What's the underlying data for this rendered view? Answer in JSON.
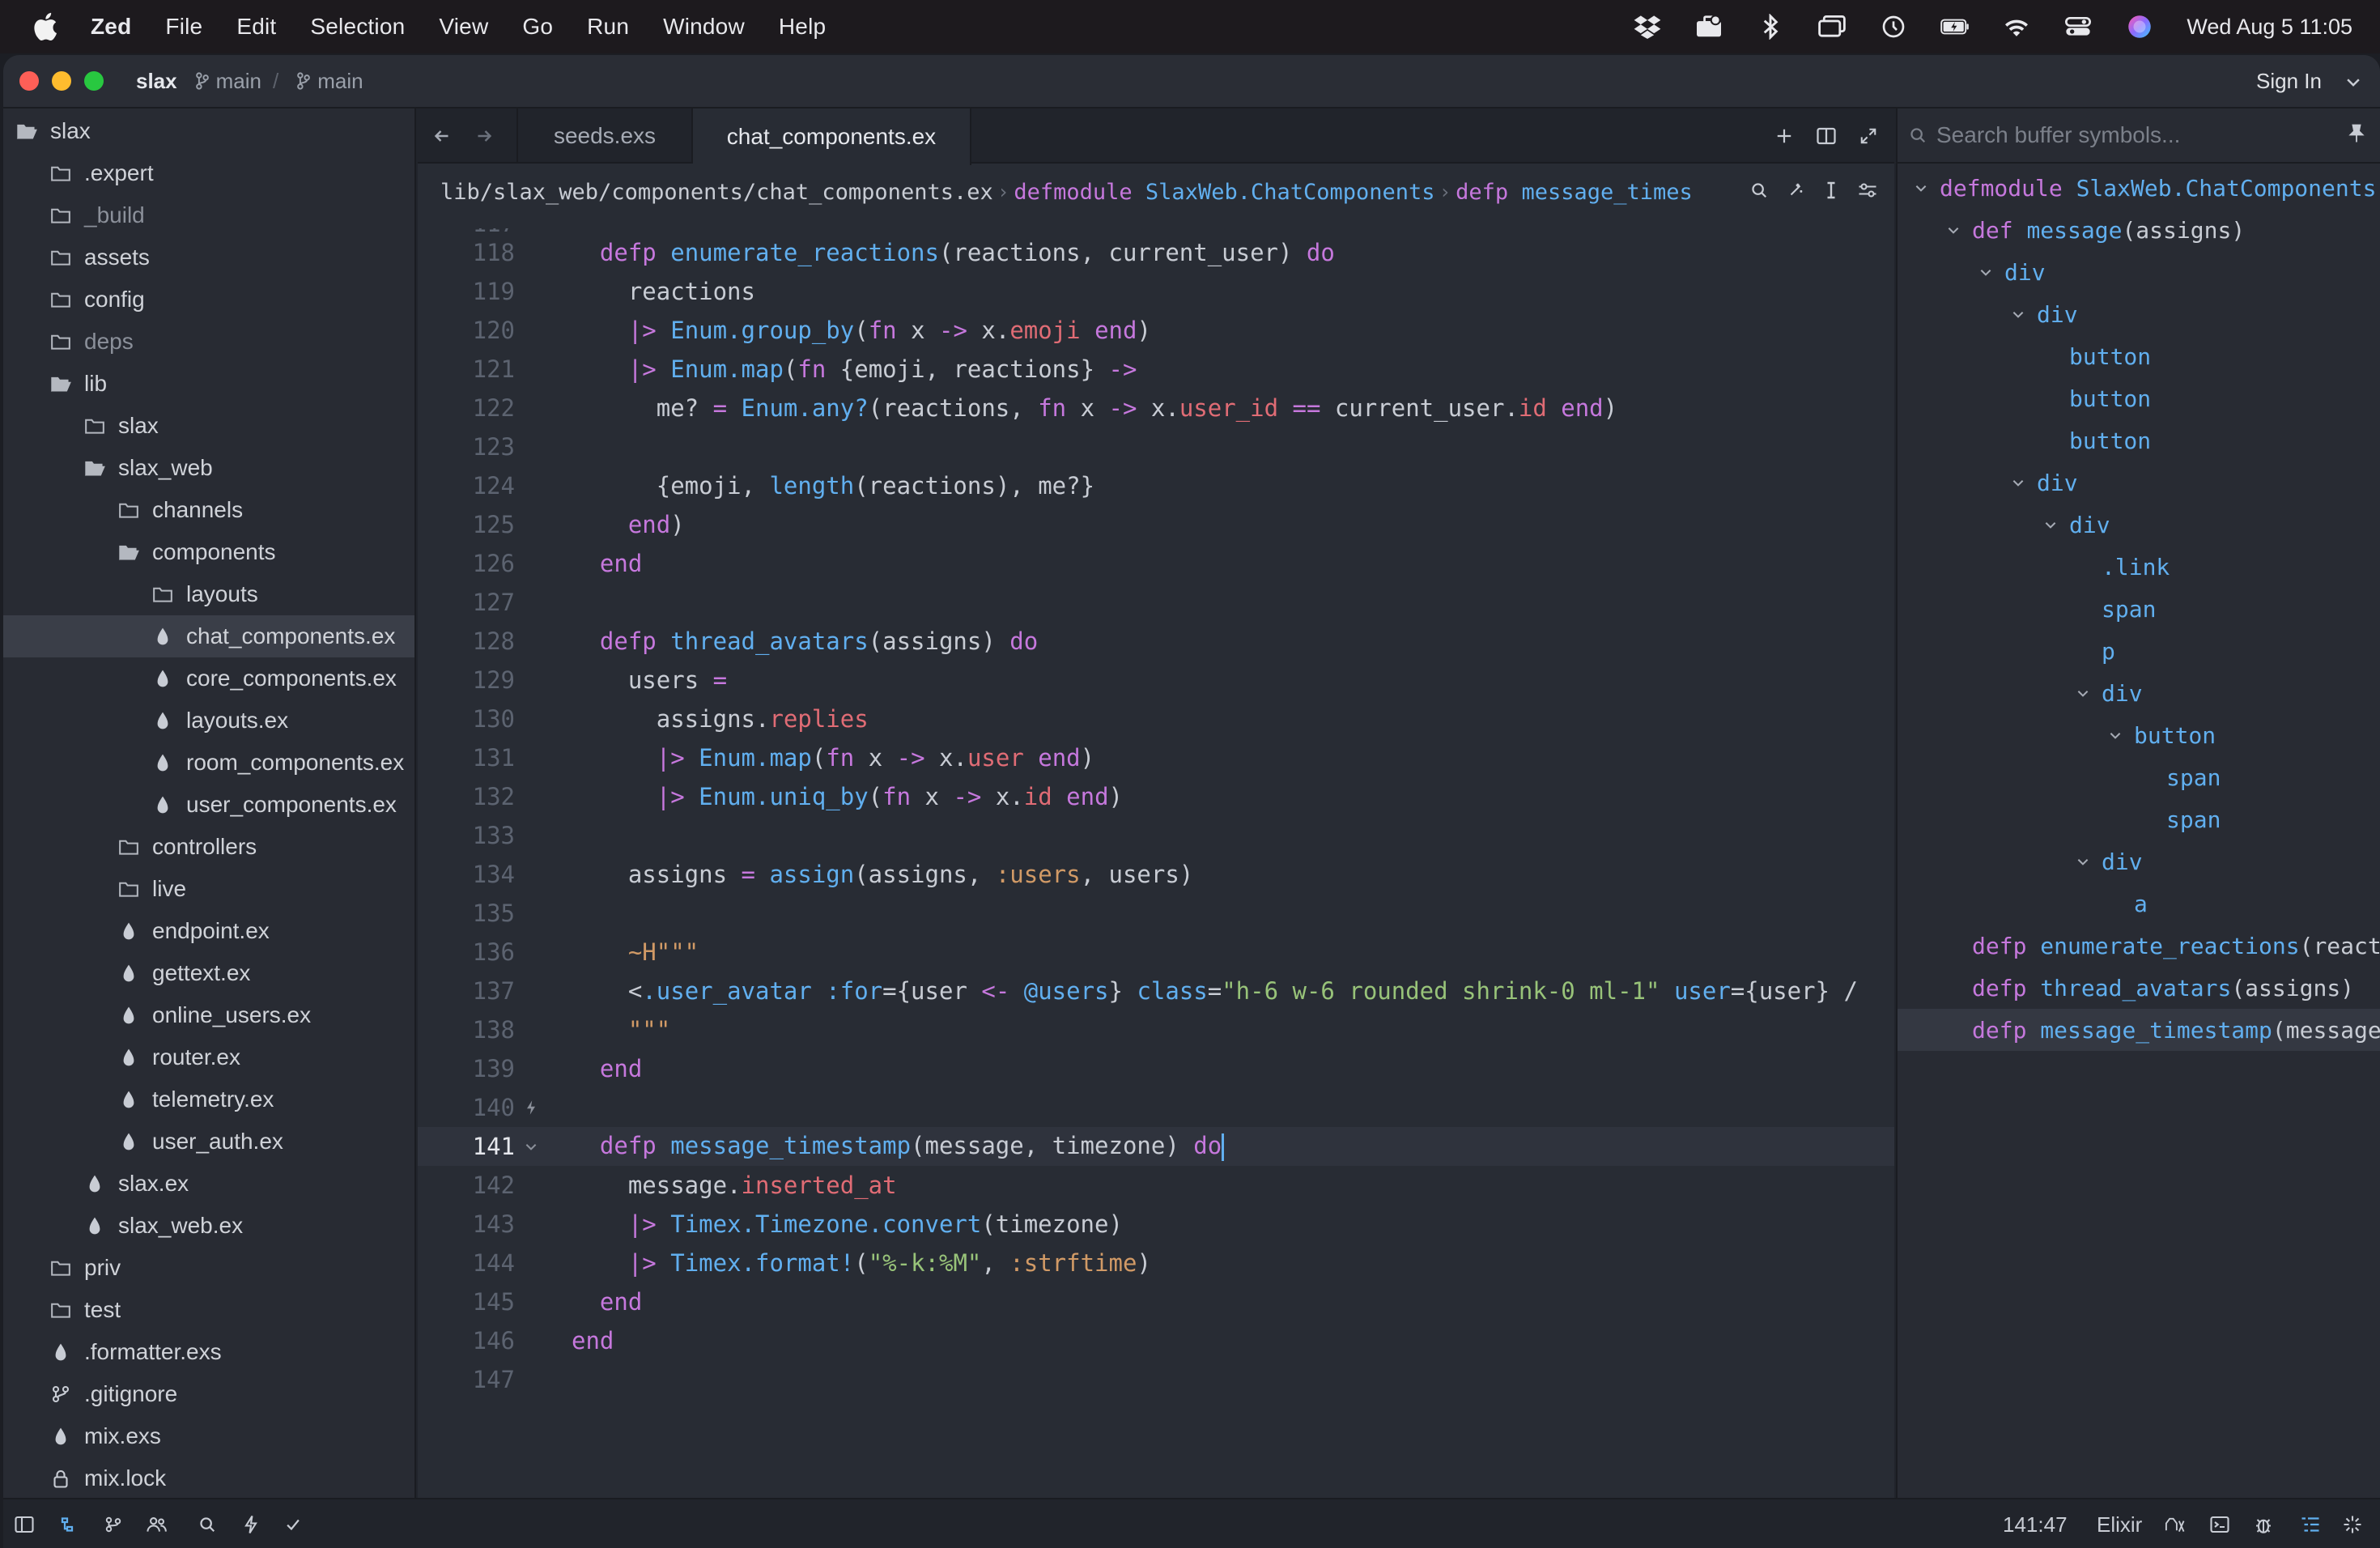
{
  "menubar": {
    "app": "Zed",
    "items": [
      "File",
      "Edit",
      "Selection",
      "View",
      "Go",
      "Run",
      "Window",
      "Help"
    ],
    "clock": "Wed Aug 5  11:05",
    "status_icons": [
      "dropbox-icon",
      "briefcase-icon",
      "bluetooth-icon",
      "screens-icon",
      "time-machine-icon",
      "battery-icon",
      "wifi-icon",
      "control-center-icon",
      "siri-icon"
    ]
  },
  "titlebar": {
    "project": "slax",
    "branch1": "main",
    "branch2": "main",
    "sign_in": "Sign In"
  },
  "project_panel": {
    "rows": [
      {
        "label": "slax",
        "icon": "folder-open",
        "depth": 0
      },
      {
        "label": ".expert",
        "icon": "folder",
        "depth": 1
      },
      {
        "label": "_build",
        "icon": "folder",
        "depth": 1,
        "dim": true
      },
      {
        "label": "assets",
        "icon": "folder",
        "depth": 1
      },
      {
        "label": "config",
        "icon": "folder",
        "depth": 1
      },
      {
        "label": "deps",
        "icon": "folder",
        "depth": 1,
        "dim": true
      },
      {
        "label": "lib",
        "icon": "folder-open",
        "depth": 1
      },
      {
        "label": "slax",
        "icon": "folder",
        "depth": 2
      },
      {
        "label": "slax_web",
        "icon": "folder-open",
        "depth": 2
      },
      {
        "label": "channels",
        "icon": "folder",
        "depth": 3
      },
      {
        "label": "components",
        "icon": "folder-open",
        "depth": 3
      },
      {
        "label": "layouts",
        "icon": "folder",
        "depth": 4
      },
      {
        "label": "chat_components.ex",
        "icon": "elixir",
        "depth": 4,
        "selected": true
      },
      {
        "label": "core_components.ex",
        "icon": "elixir",
        "depth": 4
      },
      {
        "label": "layouts.ex",
        "icon": "elixir",
        "depth": 4
      },
      {
        "label": "room_components.ex",
        "icon": "elixir",
        "depth": 4
      },
      {
        "label": "user_components.ex",
        "icon": "elixir",
        "depth": 4
      },
      {
        "label": "controllers",
        "icon": "folder",
        "depth": 3
      },
      {
        "label": "live",
        "icon": "folder",
        "depth": 3
      },
      {
        "label": "endpoint.ex",
        "icon": "elixir",
        "depth": 3
      },
      {
        "label": "gettext.ex",
        "icon": "elixir",
        "depth": 3
      },
      {
        "label": "online_users.ex",
        "icon": "elixir",
        "depth": 3
      },
      {
        "label": "router.ex",
        "icon": "elixir",
        "depth": 3
      },
      {
        "label": "telemetry.ex",
        "icon": "elixir",
        "depth": 3
      },
      {
        "label": "user_auth.ex",
        "icon": "elixir",
        "depth": 3
      },
      {
        "label": "slax.ex",
        "icon": "elixir",
        "depth": 2
      },
      {
        "label": "slax_web.ex",
        "icon": "elixir",
        "depth": 2
      },
      {
        "label": "priv",
        "icon": "folder",
        "depth": 1
      },
      {
        "label": "test",
        "icon": "folder",
        "depth": 1
      },
      {
        "label": ".formatter.exs",
        "icon": "elixir",
        "depth": 1
      },
      {
        "label": ".gitignore",
        "icon": "git",
        "depth": 1
      },
      {
        "label": "mix.exs",
        "icon": "elixir",
        "depth": 1
      },
      {
        "label": "mix.lock",
        "icon": "lock",
        "depth": 1
      }
    ]
  },
  "tabs": {
    "items": [
      {
        "label": "seeds.exs",
        "active": false
      },
      {
        "label": "chat_components.ex",
        "active": true
      }
    ]
  },
  "breadcrumb": {
    "path": "lib/slax_web/components/chat_components.ex",
    "kw1": "defmodule",
    "module": "SlaxWeb.ChatComponents",
    "kw2": "defp",
    "fn": "message_times"
  },
  "editor": {
    "top_partial_line": "117",
    "lines": [
      {
        "n": "118",
        "tokens": [
          [
            "k",
            "defp "
          ],
          [
            "f",
            "enumerate_reactions"
          ],
          [
            "p",
            "(reactions, current_user) "
          ],
          [
            "k",
            "do"
          ]
        ],
        "indent": 1
      },
      {
        "n": "119",
        "tokens": [
          [
            "p",
            "reactions"
          ]
        ],
        "indent": 2
      },
      {
        "n": "120",
        "tokens": [
          [
            "k",
            "|> "
          ],
          [
            "f",
            "Enum.group_by"
          ],
          [
            "p",
            "("
          ],
          [
            "k",
            "fn "
          ],
          [
            "p",
            "x "
          ],
          [
            "k",
            "-> "
          ],
          [
            "p",
            "x."
          ],
          [
            "fld",
            "emoji"
          ],
          [
            "p",
            " "
          ],
          [
            "k",
            "end"
          ],
          [
            "p",
            ")"
          ]
        ],
        "indent": 2
      },
      {
        "n": "121",
        "tokens": [
          [
            "k",
            "|> "
          ],
          [
            "f",
            "Enum.map"
          ],
          [
            "p",
            "("
          ],
          [
            "k",
            "fn "
          ],
          [
            "p",
            "{emoji, reactions} "
          ],
          [
            "k",
            "->"
          ]
        ],
        "indent": 2
      },
      {
        "n": "122",
        "tokens": [
          [
            "p",
            "me? "
          ],
          [
            "k",
            "= "
          ],
          [
            "f",
            "Enum.any?"
          ],
          [
            "p",
            "(reactions, "
          ],
          [
            "k",
            "fn "
          ],
          [
            "p",
            "x "
          ],
          [
            "k",
            "-> "
          ],
          [
            "p",
            "x."
          ],
          [
            "fld",
            "user_id"
          ],
          [
            "p",
            " "
          ],
          [
            "k",
            "== "
          ],
          [
            "p",
            "current_user."
          ],
          [
            "fld",
            "id"
          ],
          [
            "p",
            " "
          ],
          [
            "k",
            "end"
          ],
          [
            "p",
            ")"
          ]
        ],
        "indent": 3
      },
      {
        "n": "123",
        "tokens": [],
        "indent": 0
      },
      {
        "n": "124",
        "tokens": [
          [
            "p",
            "{emoji, "
          ],
          [
            "f",
            "length"
          ],
          [
            "p",
            "(reactions), me?}"
          ]
        ],
        "indent": 3
      },
      {
        "n": "125",
        "tokens": [
          [
            "k",
            "end"
          ],
          [
            "p",
            ")"
          ]
        ],
        "indent": 2
      },
      {
        "n": "126",
        "tokens": [
          [
            "k",
            "end"
          ]
        ],
        "indent": 1
      },
      {
        "n": "127",
        "tokens": [],
        "indent": 0
      },
      {
        "n": "128",
        "tokens": [
          [
            "k",
            "defp "
          ],
          [
            "f",
            "thread_avatars"
          ],
          [
            "p",
            "(assigns) "
          ],
          [
            "k",
            "do"
          ]
        ],
        "indent": 1
      },
      {
        "n": "129",
        "tokens": [
          [
            "p",
            "users "
          ],
          [
            "k",
            "="
          ]
        ],
        "indent": 2
      },
      {
        "n": "130",
        "tokens": [
          [
            "p",
            "assigns."
          ],
          [
            "fld",
            "replies"
          ]
        ],
        "indent": 3
      },
      {
        "n": "131",
        "tokens": [
          [
            "k",
            "|> "
          ],
          [
            "f",
            "Enum.map"
          ],
          [
            "p",
            "("
          ],
          [
            "k",
            "fn "
          ],
          [
            "p",
            "x "
          ],
          [
            "k",
            "-> "
          ],
          [
            "p",
            "x."
          ],
          [
            "fld",
            "user"
          ],
          [
            "p",
            " "
          ],
          [
            "k",
            "end"
          ],
          [
            "p",
            ")"
          ]
        ],
        "indent": 3
      },
      {
        "n": "132",
        "tokens": [
          [
            "k",
            "|> "
          ],
          [
            "f",
            "Enum.uniq_by"
          ],
          [
            "p",
            "("
          ],
          [
            "k",
            "fn "
          ],
          [
            "p",
            "x "
          ],
          [
            "k",
            "-> "
          ],
          [
            "p",
            "x."
          ],
          [
            "fld",
            "id"
          ],
          [
            "p",
            " "
          ],
          [
            "k",
            "end"
          ],
          [
            "p",
            ")"
          ]
        ],
        "indent": 3
      },
      {
        "n": "133",
        "tokens": [],
        "indent": 0
      },
      {
        "n": "134",
        "tokens": [
          [
            "p",
            "assigns "
          ],
          [
            "k",
            "= "
          ],
          [
            "f",
            "assign"
          ],
          [
            "p",
            "(assigns, "
          ],
          [
            "a",
            ":users"
          ],
          [
            "p",
            ", users)"
          ]
        ],
        "indent": 2
      },
      {
        "n": "135",
        "tokens": [],
        "indent": 0
      },
      {
        "n": "136",
        "tokens": [
          [
            "a",
            "~H\"\"\""
          ]
        ],
        "indent": 2
      },
      {
        "n": "137",
        "tokens": [
          [
            "p",
            "<"
          ],
          [
            "f",
            ".user_avatar"
          ],
          [
            "p",
            " "
          ],
          [
            "at",
            ":for"
          ],
          [
            "p",
            "={user "
          ],
          [
            "k",
            "<- "
          ],
          [
            "at",
            "@users"
          ],
          [
            "p",
            "} "
          ],
          [
            "at",
            "class"
          ],
          [
            "p",
            "="
          ],
          [
            "s",
            "\"h-6 w-6 rounded shrink-0 ml-1\""
          ],
          [
            "p",
            " "
          ],
          [
            "at",
            "user"
          ],
          [
            "p",
            "={user} /"
          ]
        ],
        "indent": 2
      },
      {
        "n": "138",
        "tokens": [
          [
            "a",
            "\"\"\""
          ]
        ],
        "indent": 2
      },
      {
        "n": "139",
        "tokens": [
          [
            "k",
            "end"
          ]
        ],
        "indent": 1
      },
      {
        "n": "140",
        "tokens": [],
        "indent": 0
      },
      {
        "n": "141",
        "tokens": [
          [
            "k",
            "defp "
          ],
          [
            "f",
            "message_timestamp"
          ],
          [
            "p",
            "(message, timezone) "
          ],
          [
            "k",
            "do"
          ]
        ],
        "indent": 1,
        "current": true
      },
      {
        "n": "142",
        "tokens": [
          [
            "p",
            "message."
          ],
          [
            "fld",
            "inserted_at"
          ]
        ],
        "indent": 2
      },
      {
        "n": "143",
        "tokens": [
          [
            "k",
            "|> "
          ],
          [
            "f",
            "Timex.Timezone.convert"
          ],
          [
            "p",
            "(timezone)"
          ]
        ],
        "indent": 2
      },
      {
        "n": "144",
        "tokens": [
          [
            "k",
            "|> "
          ],
          [
            "f",
            "Timex.format!"
          ],
          [
            "p",
            "("
          ],
          [
            "s",
            "\"%-k:%M\""
          ],
          [
            "p",
            ", "
          ],
          [
            "a",
            ":strftime"
          ],
          [
            "p",
            ")"
          ]
        ],
        "indent": 2
      },
      {
        "n": "145",
        "tokens": [
          [
            "k",
            "end"
          ]
        ],
        "indent": 1
      },
      {
        "n": "146",
        "tokens": [
          [
            "k",
            "end"
          ]
        ],
        "indent": 0
      },
      {
        "n": "147",
        "tokens": [],
        "indent": 0
      }
    ]
  },
  "outline": {
    "placeholder": "Search buffer symbols...",
    "rows": [
      {
        "kw": "defmodule ",
        "name": "SlaxWeb.ChatComponents",
        "depth": 0,
        "chev": true
      },
      {
        "kw": "def ",
        "name": "message",
        "args": "(assigns)",
        "depth": 1,
        "chev": true
      },
      {
        "kw": "",
        "name": "div",
        "depth": 2,
        "chev": true
      },
      {
        "kw": "",
        "name": "div",
        "depth": 3,
        "chev": true
      },
      {
        "kw": "",
        "name": "button",
        "depth": 4,
        "chev": false
      },
      {
        "kw": "",
        "name": "button",
        "depth": 4,
        "chev": false
      },
      {
        "kw": "",
        "name": "button",
        "depth": 4,
        "chev": false
      },
      {
        "kw": "",
        "name": "div",
        "depth": 3,
        "chev": true
      },
      {
        "kw": "",
        "name": "div",
        "depth": 4,
        "chev": true
      },
      {
        "kw": "",
        "name": ".link",
        "depth": 5,
        "chev": false
      },
      {
        "kw": "",
        "name": "span",
        "depth": 5,
        "chev": false
      },
      {
        "kw": "",
        "name": "p",
        "depth": 5,
        "chev": false
      },
      {
        "kw": "",
        "name": "div",
        "depth": 5,
        "chev": true
      },
      {
        "kw": "",
        "name": "button",
        "depth": 6,
        "chev": true
      },
      {
        "kw": "",
        "name": "span",
        "depth": 7,
        "chev": false
      },
      {
        "kw": "",
        "name": "span",
        "depth": 7,
        "chev": false
      },
      {
        "kw": "",
        "name": "div",
        "depth": 5,
        "chev": true
      },
      {
        "kw": "",
        "name": "a",
        "depth": 6,
        "chev": false
      },
      {
        "kw": "defp ",
        "name": "enumerate_reactions",
        "args": "(react",
        "depth": 1,
        "chev": false
      },
      {
        "kw": "defp ",
        "name": "thread_avatars",
        "args": "(assigns)",
        "depth": 1,
        "chev": false
      },
      {
        "kw": "defp ",
        "name": "message_timestamp",
        "args": "(message",
        "depth": 1,
        "chev": false,
        "selected": true
      }
    ]
  },
  "statusbar": {
    "position": "141:47",
    "language": "Elixir"
  },
  "colors": {
    "keyword": "#c678dd",
    "function": "#61afef",
    "string": "#98c379",
    "atom": "#d19a66",
    "field": "#e06c75"
  }
}
